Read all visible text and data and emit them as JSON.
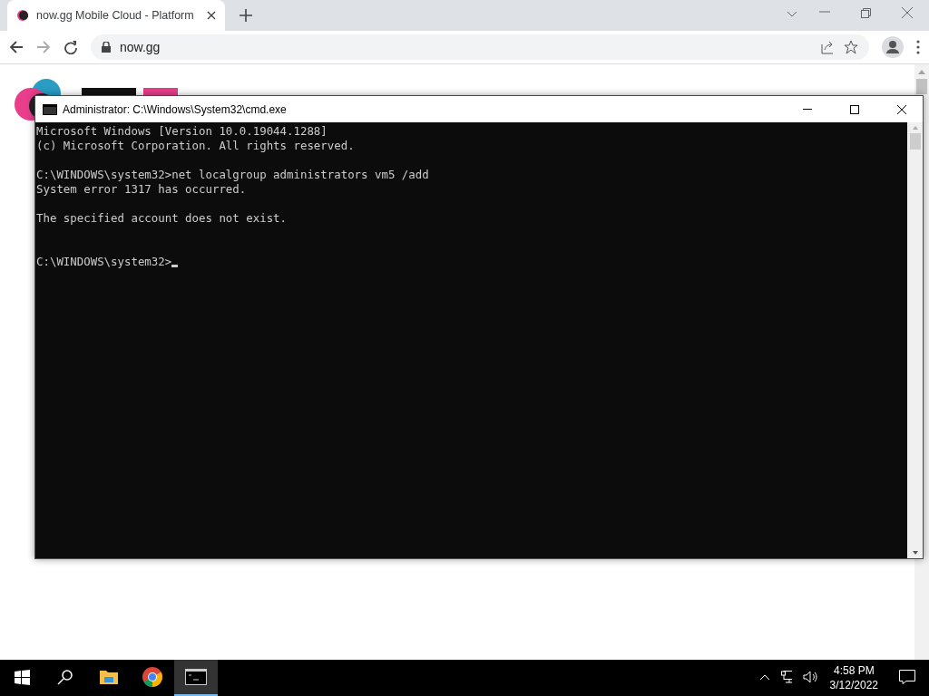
{
  "browser": {
    "tabs": [
      {
        "title": "now.gg Mobile Cloud - Platform",
        "selected": true
      }
    ],
    "address": "now.gg"
  },
  "console_window": {
    "title": "Administrator: C:\\Windows\\System32\\cmd.exe",
    "blocks": [
      [
        "Microsoft Windows [Version 10.0.19044.1288]",
        "(c) Microsoft Corporation. All rights reserved."
      ],
      [
        "C:\\WINDOWS\\system32>net localgroup administrators vm5 /add",
        "System error 1317 has occurred."
      ],
      [
        "The specified account does not exist."
      ]
    ],
    "prompt": {
      "text": "C:\\WINDOWS\\system32>",
      "cursor": true
    }
  },
  "taskbar": {
    "apps": [
      {
        "kind": "explorer",
        "selected": false
      },
      {
        "kind": "chrome",
        "selected": false
      },
      {
        "kind": "cmd",
        "selected": true
      }
    ],
    "time": "4:58 PM",
    "date": "3/12/2022"
  }
}
